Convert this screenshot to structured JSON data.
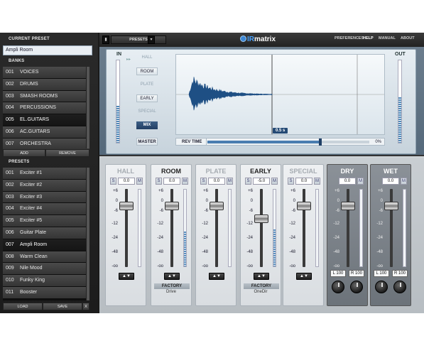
{
  "sidebar": {
    "current_preset_label": "CURRENT PRESET",
    "current_preset_value": "Ampli Room",
    "banks_label": "BANKS",
    "banks": [
      {
        "num": "001",
        "name": "VOICES"
      },
      {
        "num": "002",
        "name": "DRUMS"
      },
      {
        "num": "003",
        "name": "SMASH ROOMS"
      },
      {
        "num": "004",
        "name": "PERCUSSIONS"
      },
      {
        "num": "005",
        "name": "EL.GUITARS"
      },
      {
        "num": "006",
        "name": "AC.GUITARS"
      },
      {
        "num": "007",
        "name": "ORCHESTRA"
      }
    ],
    "add_label": "ADD",
    "remove_label": "REMOVE",
    "presets_label": "PRESETS",
    "presets": [
      {
        "num": "001",
        "name": "Exciter #1"
      },
      {
        "num": "002",
        "name": "Exciter #2"
      },
      {
        "num": "003",
        "name": "Exciter #3"
      },
      {
        "num": "004",
        "name": "Exciter #4"
      },
      {
        "num": "005",
        "name": "Exciter #5"
      },
      {
        "num": "006",
        "name": "Guitar Plate"
      },
      {
        "num": "007",
        "name": "Ampli Room"
      },
      {
        "num": "008",
        "name": "Warm Clean"
      },
      {
        "num": "009",
        "name": "Nile Mood"
      },
      {
        "num": "010",
        "name": "Funky King"
      },
      {
        "num": "011",
        "name": "Booster"
      }
    ],
    "load_label": "LOAD",
    "save_label": "SAVE",
    "close_label": "X"
  },
  "topbar": {
    "presets_label": "PRESETS",
    "logo_prefix": "IR",
    "logo_suffix": "matrix",
    "preferences": "PREFERENCES",
    "help": "HELP",
    "manual": "MANUAL",
    "about": "ABOUT"
  },
  "display": {
    "in_label": "IN",
    "out_label": "OUT",
    "in_level": 0.45,
    "out_level": 0.55,
    "channels": [
      "HALL",
      "ROOM",
      "PLATE",
      "EARLY",
      "SPECIAL",
      "MIX"
    ],
    "master_label": "MASTER",
    "rev_time_label": "REV TIME",
    "rev_time_value": "0.5 s",
    "rev_time_percent": "0%"
  },
  "mixer": {
    "scale_ticks": [
      "+6",
      "0",
      "-6",
      "-12",
      "-24",
      "-48",
      "-oo"
    ],
    "strips": [
      {
        "name": "HALL",
        "s": "S",
        "value": "0.0",
        "m": "M",
        "fader": 0.78,
        "meter": 0.0,
        "enabled": false
      },
      {
        "name": "ROOM",
        "s": "S",
        "value": "0.0",
        "m": "M",
        "fader": 0.78,
        "meter": 0.45,
        "enabled": true,
        "factory": "FACTORY",
        "preset": "Drive"
      },
      {
        "name": "PLATE",
        "s": "S",
        "value": "0.0",
        "m": "M",
        "fader": 0.78,
        "meter": 0.0,
        "enabled": false
      },
      {
        "name": "EARLY",
        "s": "S",
        "value": "-5.0",
        "m": "M",
        "fader": 0.62,
        "meter": 0.48,
        "enabled": true,
        "factory": "FACTORY",
        "preset": "OneDir"
      },
      {
        "name": "SPECIAL",
        "s": "S",
        "value": "0.0",
        "m": "M",
        "fader": 0.78,
        "meter": 0.0,
        "enabled": false
      }
    ],
    "dry": {
      "name": "DRY",
      "value": "0.0",
      "m": "M",
      "fader": 0.78,
      "l": "L 100",
      "r": "R 100"
    },
    "wet": {
      "name": "WET",
      "value": "0.0",
      "m": "M",
      "fader": 0.78,
      "l": "L 100",
      "r": "R 100"
    },
    "swap_glyph": "▲▼"
  }
}
